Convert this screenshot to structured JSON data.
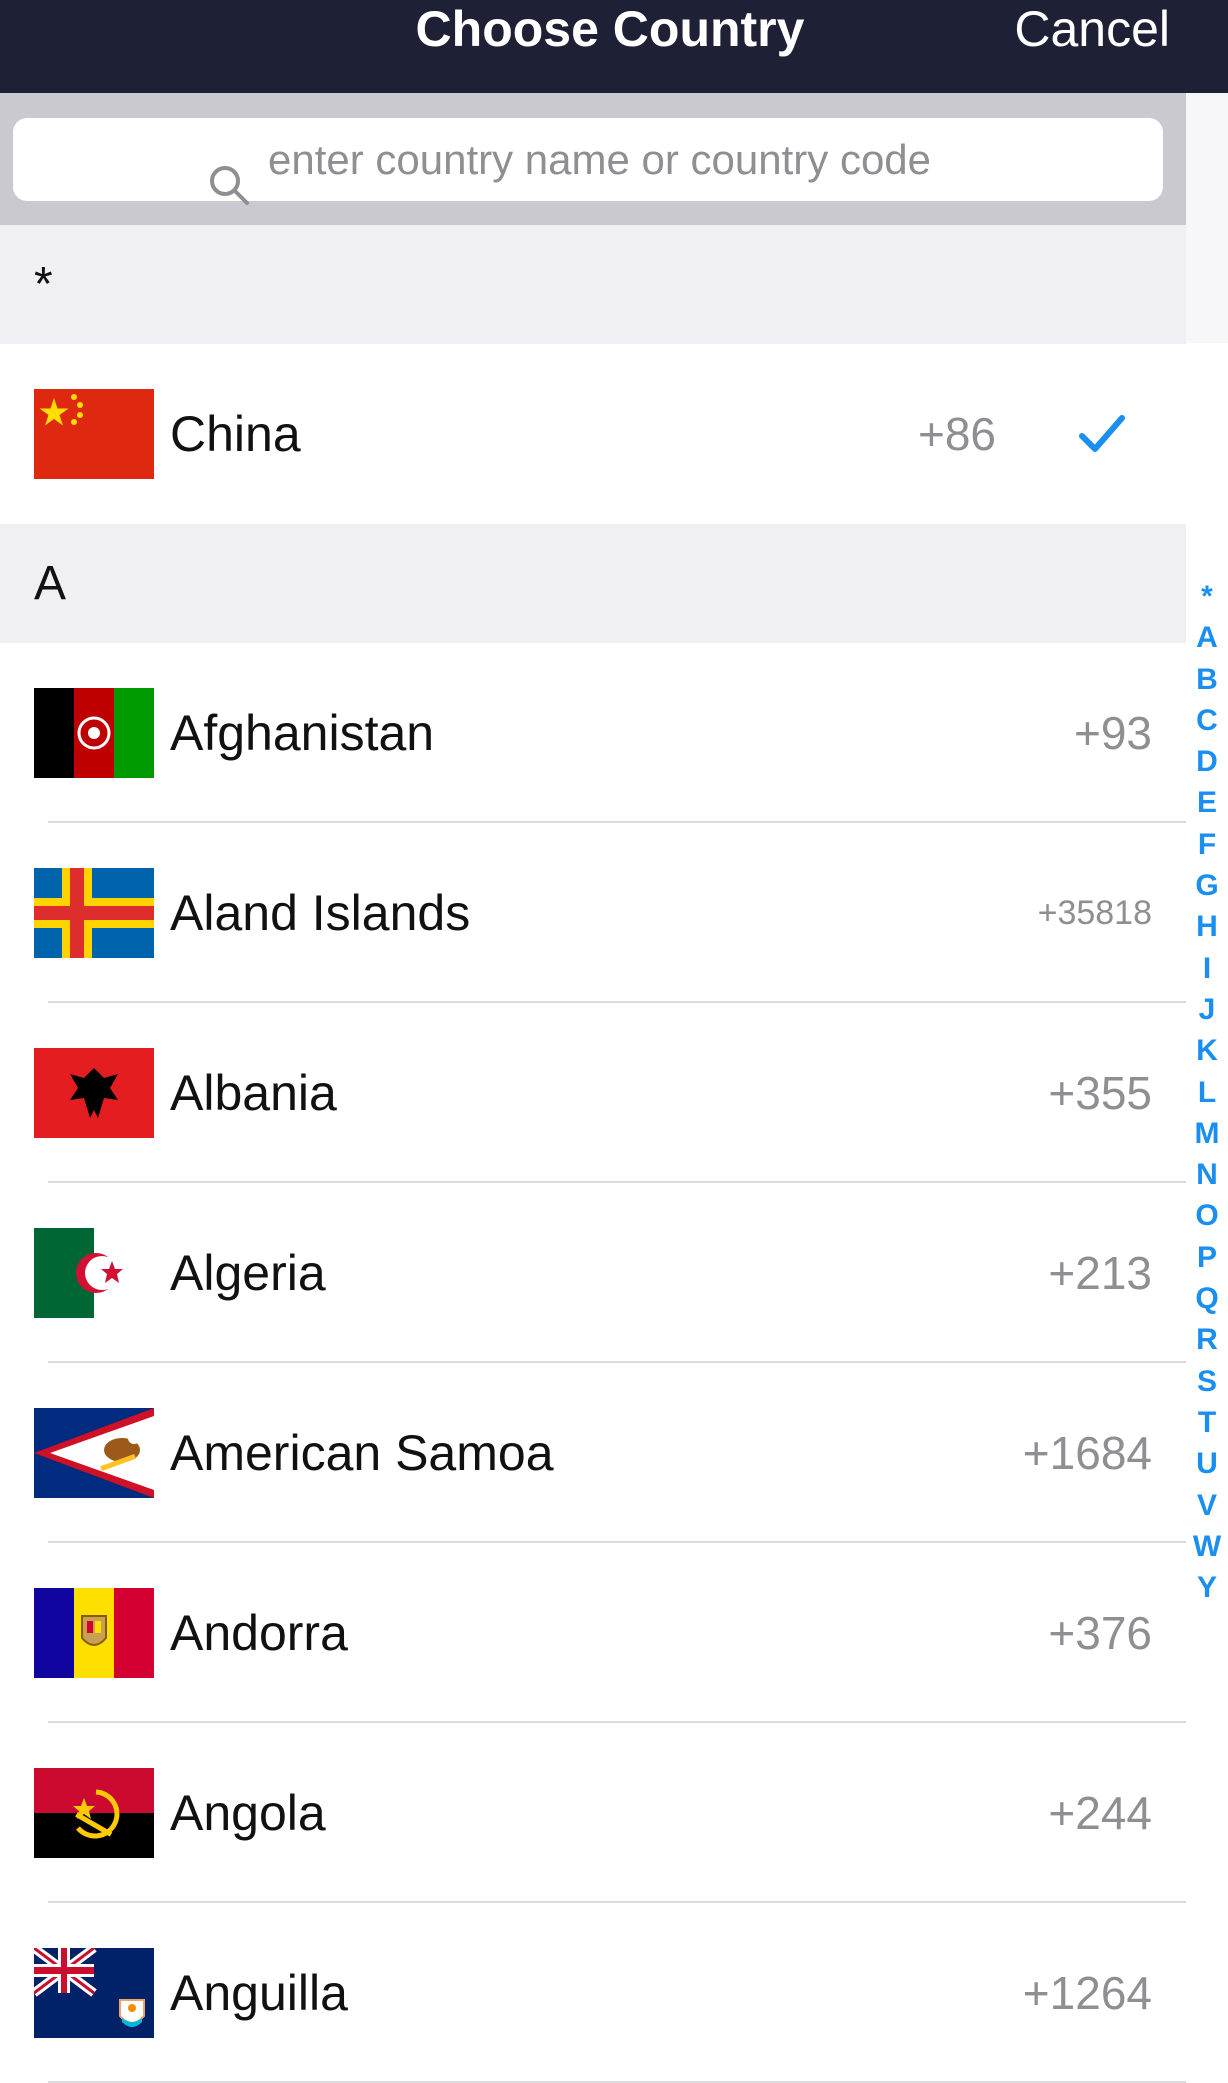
{
  "nav": {
    "title": "Choose Country",
    "cancel_label": "Cancel"
  },
  "search": {
    "placeholder": "enter country name or country code",
    "value": ""
  },
  "sections": [
    {
      "label": "*",
      "rows": [
        {
          "flag": "flag-china-icon",
          "name": "China",
          "code": "+86",
          "selected": true
        }
      ]
    },
    {
      "label": "A",
      "rows": [
        {
          "flag": "flag-afghanistan-icon",
          "name": "Afghanistan",
          "code": "+93"
        },
        {
          "flag": "flag-aland-islands-icon",
          "name": "Aland Islands",
          "code": "+35818"
        },
        {
          "flag": "flag-albania-icon",
          "name": "Albania",
          "code": "+355"
        },
        {
          "flag": "flag-algeria-icon",
          "name": "Algeria",
          "code": "+213"
        },
        {
          "flag": "flag-american-samoa-icon",
          "name": "American Samoa",
          "code": "+1684"
        },
        {
          "flag": "flag-andorra-icon",
          "name": "Andorra",
          "code": "+376"
        },
        {
          "flag": "flag-angola-icon",
          "name": "Angola",
          "code": "+244"
        },
        {
          "flag": "flag-anguilla-icon",
          "name": "Anguilla",
          "code": "+1264"
        }
      ]
    }
  ],
  "index_letters": [
    "*",
    "A",
    "B",
    "C",
    "D",
    "E",
    "F",
    "G",
    "H",
    "I",
    "J",
    "K",
    "L",
    "M",
    "N",
    "O",
    "P",
    "Q",
    "R",
    "S",
    "T",
    "U",
    "V",
    "W",
    "Y"
  ],
  "colors": {
    "nav_bg": "#1e2036",
    "accent": "#1a8ff0",
    "section_bg": "#efeff4",
    "code_gray": "#8e8e93"
  }
}
